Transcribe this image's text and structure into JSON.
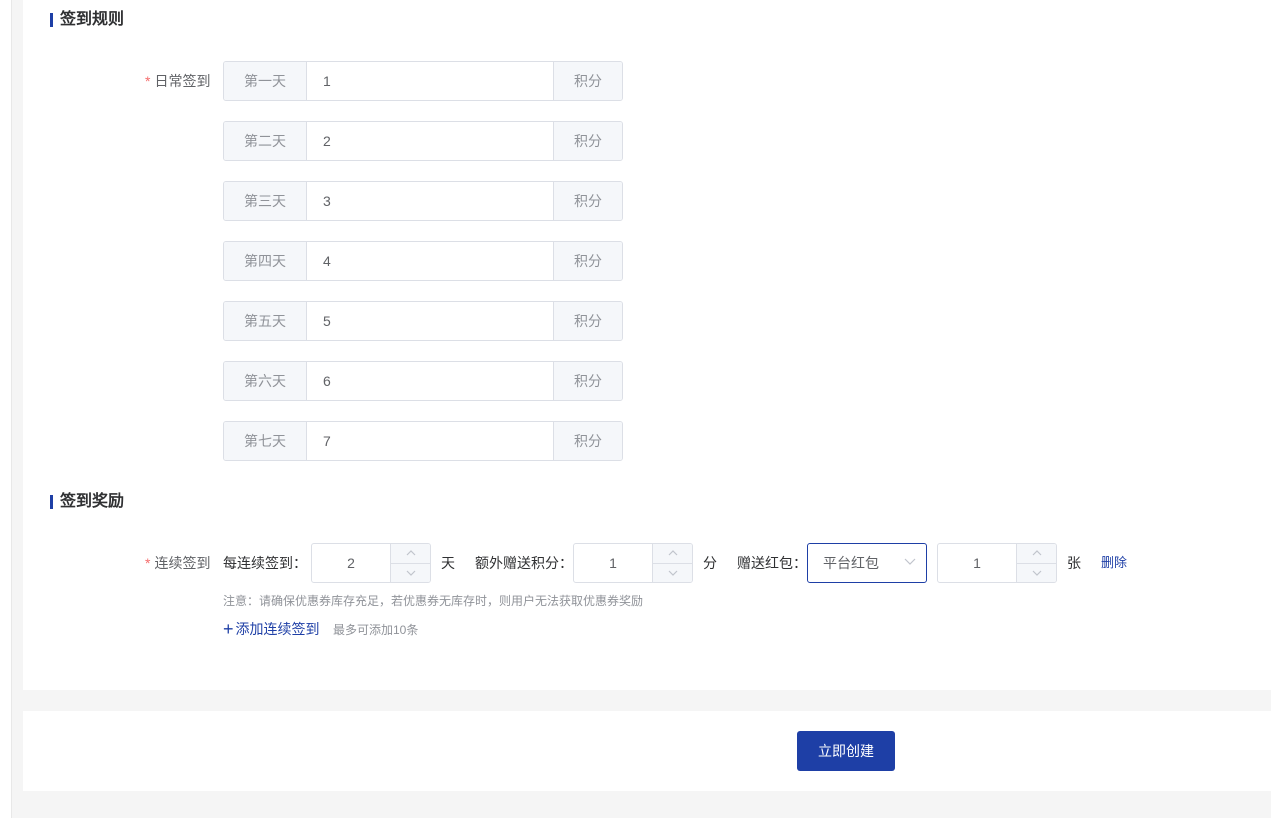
{
  "section_rules": {
    "title": "签到规则",
    "daily_label": "日常签到",
    "days": [
      {
        "prepend": "第一天",
        "value": "1",
        "append": "积分"
      },
      {
        "prepend": "第二天",
        "value": "2",
        "append": "积分"
      },
      {
        "prepend": "第三天",
        "value": "3",
        "append": "积分"
      },
      {
        "prepend": "第四天",
        "value": "4",
        "append": "积分"
      },
      {
        "prepend": "第五天",
        "value": "5",
        "append": "积分"
      },
      {
        "prepend": "第六天",
        "value": "6",
        "append": "积分"
      },
      {
        "prepend": "第七天",
        "value": "7",
        "append": "积分"
      }
    ]
  },
  "section_rewards": {
    "title": "签到奖励",
    "continuous_label": "连续签到",
    "every_label": "每连续签到：",
    "days_value": "2",
    "days_unit": "天",
    "extra_points_label": "额外赠送积分：",
    "extra_points_value": "1",
    "points_unit": "分",
    "red_packet_label": "赠送红包：",
    "red_packet_type": "平台红包",
    "red_packet_count": "1",
    "count_unit": "张",
    "delete_label": "删除",
    "note": "注意：请确保优惠券库存充足，若优惠券无库存时，则用户无法获取优惠券奖励",
    "add_label": "添加连续签到",
    "add_hint": "最多可添加10条"
  },
  "footer": {
    "submit_label": "立即创建"
  },
  "colors": {
    "accent": "#1e3fa6",
    "required": "#f56c6c"
  }
}
